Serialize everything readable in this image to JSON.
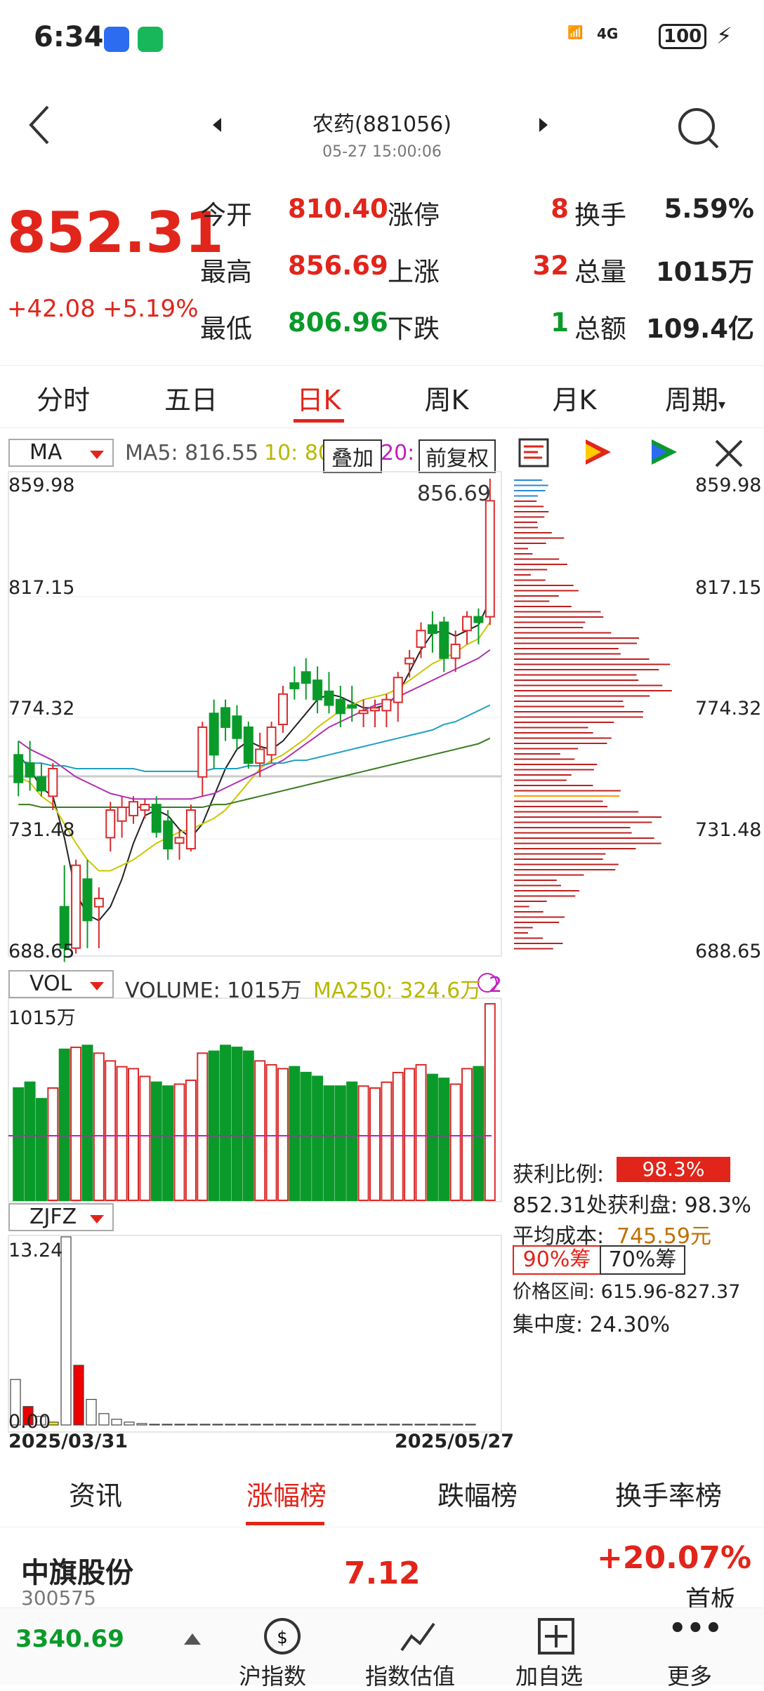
{
  "status_bar": {
    "time": "6:34",
    "signal": "6",
    "network": "4G",
    "battery": "100"
  },
  "header": {
    "title": "农药(881056)",
    "datetime": "05-27 15:00:06"
  },
  "quote": {
    "price": "852.31",
    "change": "+42.08",
    "change_pct": "+5.19%",
    "fields": [
      {
        "label": "今开",
        "value": "810.40",
        "color": "red"
      },
      {
        "label": "最高",
        "value": "856.69",
        "color": "red"
      },
      {
        "label": "最低",
        "value": "806.96",
        "color": "green"
      }
    ],
    "counts": [
      {
        "label": "涨停",
        "value": "8",
        "color": "red"
      },
      {
        "label": "上涨",
        "value": "32",
        "color": "red"
      },
      {
        "label": "下跌",
        "value": "1",
        "color": "green"
      }
    ],
    "stats": [
      {
        "label": "换手",
        "value": "5.59%"
      },
      {
        "label": "总量",
        "value": "1015万"
      },
      {
        "label": "总额",
        "value": "109.4亿"
      }
    ]
  },
  "period_tabs": [
    "分时",
    "五日",
    "日K",
    "周K",
    "月K",
    "周期"
  ],
  "active_tab": "日K",
  "indicators": {
    "ma_select": "MA",
    "ma5": "MA5: 816.55",
    "ma10": "10: 80",
    "ma20": "20: 7",
    "overlay_btn": "叠加",
    "adjust_btn": "前复权",
    "vol_select": "VOL",
    "volume_label": "VOLUME: 1015万",
    "ma250": "MA250: 324.6万",
    "vol_extra": "2",
    "zjfz_select": "ZJFZ"
  },
  "price_axis": [
    "859.98",
    "817.15",
    "774.32",
    "731.48",
    "688.65"
  ],
  "high_label": "856.69",
  "vol_axis_top": "1015万",
  "zjfz_axis": {
    "top": "13.24",
    "bottom": "0.00"
  },
  "dates": {
    "start": "2025/03/31",
    "end": "2025/05/27"
  },
  "chip": {
    "profit_label": "获利比例:",
    "profit_value": "98.3%",
    "profit_line": "852.31处获利盘: 98.3%",
    "avg_cost_label": "平均成本:",
    "avg_cost_value": "745.59元",
    "btn90": "90%筹",
    "btn70": "70%筹",
    "range": "价格区间: 615.96-827.37",
    "concentration": "集中度: 24.30%"
  },
  "list_tabs": [
    "资讯",
    "涨幅榜",
    "跌幅榜",
    "换手率榜"
  ],
  "active_list_tab": "涨幅榜",
  "stock_row": {
    "name": "中旗股份",
    "code": "300575",
    "price": "7.12",
    "pct": "+20.07%",
    "tag": "首板"
  },
  "bottom": {
    "index_value": "3340.69",
    "actions": [
      "沪指数",
      "指数估值",
      "加自选",
      "更多"
    ]
  },
  "chart_data": {
    "type": "candlestick",
    "ylim": [
      688.65,
      859.98
    ],
    "candles": [
      [
        760,
        765,
        745,
        750
      ],
      [
        757,
        765,
        747,
        752
      ],
      [
        752,
        757,
        745,
        747
      ],
      [
        745,
        757,
        740,
        755
      ],
      [
        705,
        720,
        685,
        690
      ],
      [
        690,
        722,
        688,
        720
      ],
      [
        715,
        722,
        690,
        700
      ],
      [
        705,
        712,
        690,
        708
      ],
      [
        730,
        743,
        725,
        740
      ],
      [
        736,
        745,
        730,
        741
      ],
      [
        738,
        745,
        735,
        743
      ],
      [
        740,
        744,
        737,
        742
      ],
      [
        742,
        745,
        730,
        732
      ],
      [
        736,
        740,
        722,
        726
      ],
      [
        728,
        733,
        722,
        730
      ],
      [
        726,
        742,
        725,
        740
      ],
      [
        752,
        772,
        745,
        770
      ],
      [
        775,
        780,
        755,
        760
      ],
      [
        777,
        780,
        765,
        770
      ],
      [
        774,
        778,
        762,
        766
      ],
      [
        770,
        772,
        755,
        757
      ],
      [
        757,
        768,
        752,
        762
      ],
      [
        760,
        772,
        757,
        770
      ],
      [
        771,
        785,
        768,
        782
      ],
      [
        786,
        792,
        780,
        784
      ],
      [
        790,
        795,
        780,
        786
      ],
      [
        787,
        792,
        775,
        780
      ],
      [
        783,
        790,
        775,
        778
      ],
      [
        780,
        785,
        770,
        775
      ],
      [
        778,
        785,
        772,
        777
      ],
      [
        775,
        780,
        770,
        776
      ],
      [
        776,
        780,
        770,
        777
      ],
      [
        776,
        782,
        770,
        780
      ],
      [
        779,
        790,
        772,
        788
      ],
      [
        793,
        798,
        788,
        795
      ],
      [
        799,
        808,
        795,
        805
      ],
      [
        807,
        812,
        797,
        804
      ],
      [
        808,
        810,
        790,
        795
      ],
      [
        795,
        805,
        790,
        800
      ],
      [
        805,
        812,
        800,
        810
      ],
      [
        810,
        813,
        800,
        808
      ],
      [
        810,
        860,
        807,
        852
      ]
    ],
    "volume": [
      580,
      610,
      525,
      580,
      780,
      790,
      800,
      760,
      720,
      690,
      680,
      640,
      610,
      590,
      600,
      620,
      760,
      770,
      800,
      790,
      770,
      720,
      700,
      680,
      690,
      660,
      640,
      590,
      590,
      610,
      590,
      580,
      610,
      660,
      680,
      700,
      650,
      630,
      600,
      680,
      690,
      1015
    ],
    "ma5": [
      760,
      755,
      748,
      745,
      730,
      710,
      702,
      700,
      705,
      715,
      728,
      738,
      740,
      738,
      733,
      730,
      735,
      745,
      755,
      762,
      765,
      763,
      762,
      765,
      770,
      775,
      780,
      782,
      781,
      779,
      777,
      777,
      778,
      782,
      790,
      798,
      804,
      805,
      803,
      805,
      807,
      816
    ],
    "ma10": [
      752,
      750,
      745,
      742,
      735,
      728,
      722,
      718,
      718,
      720,
      722,
      725,
      728,
      730,
      732,
      733,
      735,
      737,
      740,
      745,
      750,
      755,
      758,
      760,
      763,
      766,
      770,
      773,
      776,
      778,
      780,
      781,
      782,
      784,
      787,
      790,
      793,
      795,
      797,
      800,
      802,
      808
    ],
    "ma20": [
      765,
      762,
      760,
      758,
      755,
      752,
      750,
      748,
      746,
      745,
      744,
      744,
      744,
      744,
      744,
      744,
      745,
      746,
      748,
      750,
      752,
      754,
      756,
      758,
      761,
      764,
      767,
      770,
      772,
      774,
      776,
      778,
      779,
      781,
      783,
      785,
      787,
      789,
      791,
      793,
      795,
      798
    ],
    "ma60": [
      758,
      757,
      757,
      756,
      756,
      755,
      755,
      755,
      755,
      755,
      755,
      754,
      754,
      754,
      754,
      754,
      754,
      755,
      755,
      755,
      756,
      756,
      757,
      757,
      758,
      758,
      759,
      760,
      761,
      762,
      763,
      764,
      765,
      766,
      767,
      768,
      769,
      771,
      772,
      774,
      776,
      778
    ],
    "ma120": [
      742,
      742,
      741,
      741,
      741,
      741,
      741,
      741,
      741,
      741,
      741,
      741,
      741,
      741,
      741,
      741,
      741,
      742,
      742,
      743,
      744,
      745,
      746,
      747,
      748,
      749,
      750,
      751,
      752,
      753,
      754,
      755,
      756,
      757,
      758,
      759,
      760,
      761,
      762,
      763,
      764,
      766
    ],
    "zjfz": [
      3.2,
      1.3,
      0.6,
      0.2,
      13.24,
      4.2,
      1.8,
      0.8,
      0.4,
      0.2,
      0.1,
      0.05,
      0.02,
      0.02,
      0.01,
      0.01,
      0.01,
      0.01,
      0.01,
      0.01,
      0.01,
      0.01,
      0.01,
      0.01,
      0.01,
      0.01,
      0.01,
      0.01,
      0.01,
      0.01,
      0.01,
      0.01,
      0.01,
      0.01,
      0.01,
      0.01,
      0.01
    ],
    "zjfz_colors": [
      "#fff",
      "#e00",
      "#fff",
      "#ffea00",
      "#fff",
      "#e00",
      "#fff",
      "#fff",
      "#fff",
      "#fff",
      "#fff",
      "#fff",
      "#fff",
      "#fff",
      "#fff",
      "#fff",
      "#fff",
      "#fff",
      "#fff",
      "#fff",
      "#fff",
      "#fff",
      "#fff",
      "#fff",
      "#fff",
      "#fff",
      "#fff",
      "#fff",
      "#fff",
      "#fff",
      "#fff",
      "#fff",
      "#fff",
      "#fff",
      "#fff",
      "#fff",
      "#fff"
    ]
  }
}
